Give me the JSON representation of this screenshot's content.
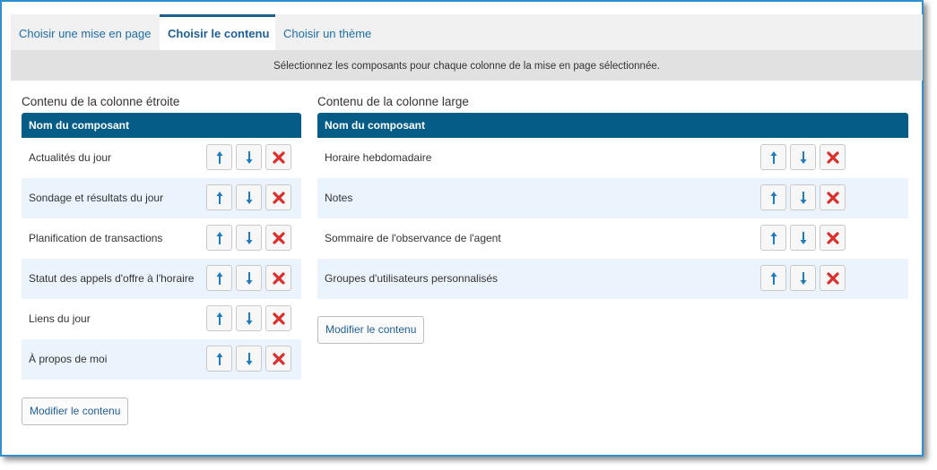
{
  "tabs": [
    {
      "label": "Choisir une mise en page"
    },
    {
      "label": "Choisir le contenu"
    },
    {
      "label": "Choisir un thème"
    }
  ],
  "instructions": "Sélectionnez les composants pour chaque colonne de la mise en page sélectionnée.",
  "narrow": {
    "title": "Contenu de la colonne étroite",
    "header": "Nom du composant",
    "rows": [
      {
        "label": "Actualités du jour"
      },
      {
        "label": "Sondage et résultats du jour"
      },
      {
        "label": "Planification de transactions"
      },
      {
        "label": "Statut des appels d'offre à l'horaire"
      },
      {
        "label": "Liens du jour"
      },
      {
        "label": "À propos de moi"
      }
    ],
    "modify_label": "Modifier le contenu"
  },
  "wide": {
    "title": "Contenu de la colonne large",
    "header": "Nom du composant",
    "rows": [
      {
        "label": "Horaire hebdomadaire"
      },
      {
        "label": "Notes"
      },
      {
        "label": "Sommaire de l'observance de l'agent"
      },
      {
        "label": "Groupes d'utilisateurs personnalisés"
      }
    ],
    "modify_label": "Modifier le contenu"
  },
  "icons": {
    "up": "arrow-up-icon",
    "down": "arrow-down-icon",
    "remove": "close-icon"
  },
  "colors": {
    "accent": "#045c87",
    "arrow": "#1e7bc0",
    "remove": "#d9302c",
    "alt_row": "#ebf4fc"
  }
}
